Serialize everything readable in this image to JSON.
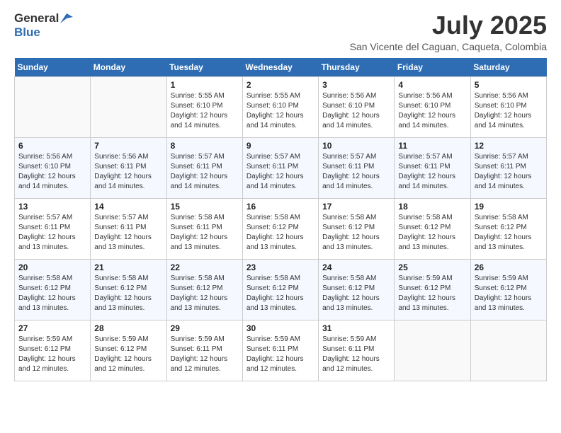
{
  "logo": {
    "line1": "General",
    "line2": "Blue"
  },
  "title": "July 2025",
  "subtitle": "San Vicente del Caguan, Caqueta, Colombia",
  "weekdays": [
    "Sunday",
    "Monday",
    "Tuesday",
    "Wednesday",
    "Thursday",
    "Friday",
    "Saturday"
  ],
  "weeks": [
    [
      {
        "day": "",
        "info": ""
      },
      {
        "day": "",
        "info": ""
      },
      {
        "day": "1",
        "info": "Sunrise: 5:55 AM\nSunset: 6:10 PM\nDaylight: 12 hours and 14 minutes."
      },
      {
        "day": "2",
        "info": "Sunrise: 5:55 AM\nSunset: 6:10 PM\nDaylight: 12 hours and 14 minutes."
      },
      {
        "day": "3",
        "info": "Sunrise: 5:56 AM\nSunset: 6:10 PM\nDaylight: 12 hours and 14 minutes."
      },
      {
        "day": "4",
        "info": "Sunrise: 5:56 AM\nSunset: 6:10 PM\nDaylight: 12 hours and 14 minutes."
      },
      {
        "day": "5",
        "info": "Sunrise: 5:56 AM\nSunset: 6:10 PM\nDaylight: 12 hours and 14 minutes."
      }
    ],
    [
      {
        "day": "6",
        "info": "Sunrise: 5:56 AM\nSunset: 6:10 PM\nDaylight: 12 hours and 14 minutes."
      },
      {
        "day": "7",
        "info": "Sunrise: 5:56 AM\nSunset: 6:11 PM\nDaylight: 12 hours and 14 minutes."
      },
      {
        "day": "8",
        "info": "Sunrise: 5:57 AM\nSunset: 6:11 PM\nDaylight: 12 hours and 14 minutes."
      },
      {
        "day": "9",
        "info": "Sunrise: 5:57 AM\nSunset: 6:11 PM\nDaylight: 12 hours and 14 minutes."
      },
      {
        "day": "10",
        "info": "Sunrise: 5:57 AM\nSunset: 6:11 PM\nDaylight: 12 hours and 14 minutes."
      },
      {
        "day": "11",
        "info": "Sunrise: 5:57 AM\nSunset: 6:11 PM\nDaylight: 12 hours and 14 minutes."
      },
      {
        "day": "12",
        "info": "Sunrise: 5:57 AM\nSunset: 6:11 PM\nDaylight: 12 hours and 14 minutes."
      }
    ],
    [
      {
        "day": "13",
        "info": "Sunrise: 5:57 AM\nSunset: 6:11 PM\nDaylight: 12 hours and 13 minutes."
      },
      {
        "day": "14",
        "info": "Sunrise: 5:57 AM\nSunset: 6:11 PM\nDaylight: 12 hours and 13 minutes."
      },
      {
        "day": "15",
        "info": "Sunrise: 5:58 AM\nSunset: 6:11 PM\nDaylight: 12 hours and 13 minutes."
      },
      {
        "day": "16",
        "info": "Sunrise: 5:58 AM\nSunset: 6:12 PM\nDaylight: 12 hours and 13 minutes."
      },
      {
        "day": "17",
        "info": "Sunrise: 5:58 AM\nSunset: 6:12 PM\nDaylight: 12 hours and 13 minutes."
      },
      {
        "day": "18",
        "info": "Sunrise: 5:58 AM\nSunset: 6:12 PM\nDaylight: 12 hours and 13 minutes."
      },
      {
        "day": "19",
        "info": "Sunrise: 5:58 AM\nSunset: 6:12 PM\nDaylight: 12 hours and 13 minutes."
      }
    ],
    [
      {
        "day": "20",
        "info": "Sunrise: 5:58 AM\nSunset: 6:12 PM\nDaylight: 12 hours and 13 minutes."
      },
      {
        "day": "21",
        "info": "Sunrise: 5:58 AM\nSunset: 6:12 PM\nDaylight: 12 hours and 13 minutes."
      },
      {
        "day": "22",
        "info": "Sunrise: 5:58 AM\nSunset: 6:12 PM\nDaylight: 12 hours and 13 minutes."
      },
      {
        "day": "23",
        "info": "Sunrise: 5:58 AM\nSunset: 6:12 PM\nDaylight: 12 hours and 13 minutes."
      },
      {
        "day": "24",
        "info": "Sunrise: 5:58 AM\nSunset: 6:12 PM\nDaylight: 12 hours and 13 minutes."
      },
      {
        "day": "25",
        "info": "Sunrise: 5:59 AM\nSunset: 6:12 PM\nDaylight: 12 hours and 13 minutes."
      },
      {
        "day": "26",
        "info": "Sunrise: 5:59 AM\nSunset: 6:12 PM\nDaylight: 12 hours and 13 minutes."
      }
    ],
    [
      {
        "day": "27",
        "info": "Sunrise: 5:59 AM\nSunset: 6:12 PM\nDaylight: 12 hours and 12 minutes."
      },
      {
        "day": "28",
        "info": "Sunrise: 5:59 AM\nSunset: 6:12 PM\nDaylight: 12 hours and 12 minutes."
      },
      {
        "day": "29",
        "info": "Sunrise: 5:59 AM\nSunset: 6:11 PM\nDaylight: 12 hours and 12 minutes."
      },
      {
        "day": "30",
        "info": "Sunrise: 5:59 AM\nSunset: 6:11 PM\nDaylight: 12 hours and 12 minutes."
      },
      {
        "day": "31",
        "info": "Sunrise: 5:59 AM\nSunset: 6:11 PM\nDaylight: 12 hours and 12 minutes."
      },
      {
        "day": "",
        "info": ""
      },
      {
        "day": "",
        "info": ""
      }
    ]
  ]
}
